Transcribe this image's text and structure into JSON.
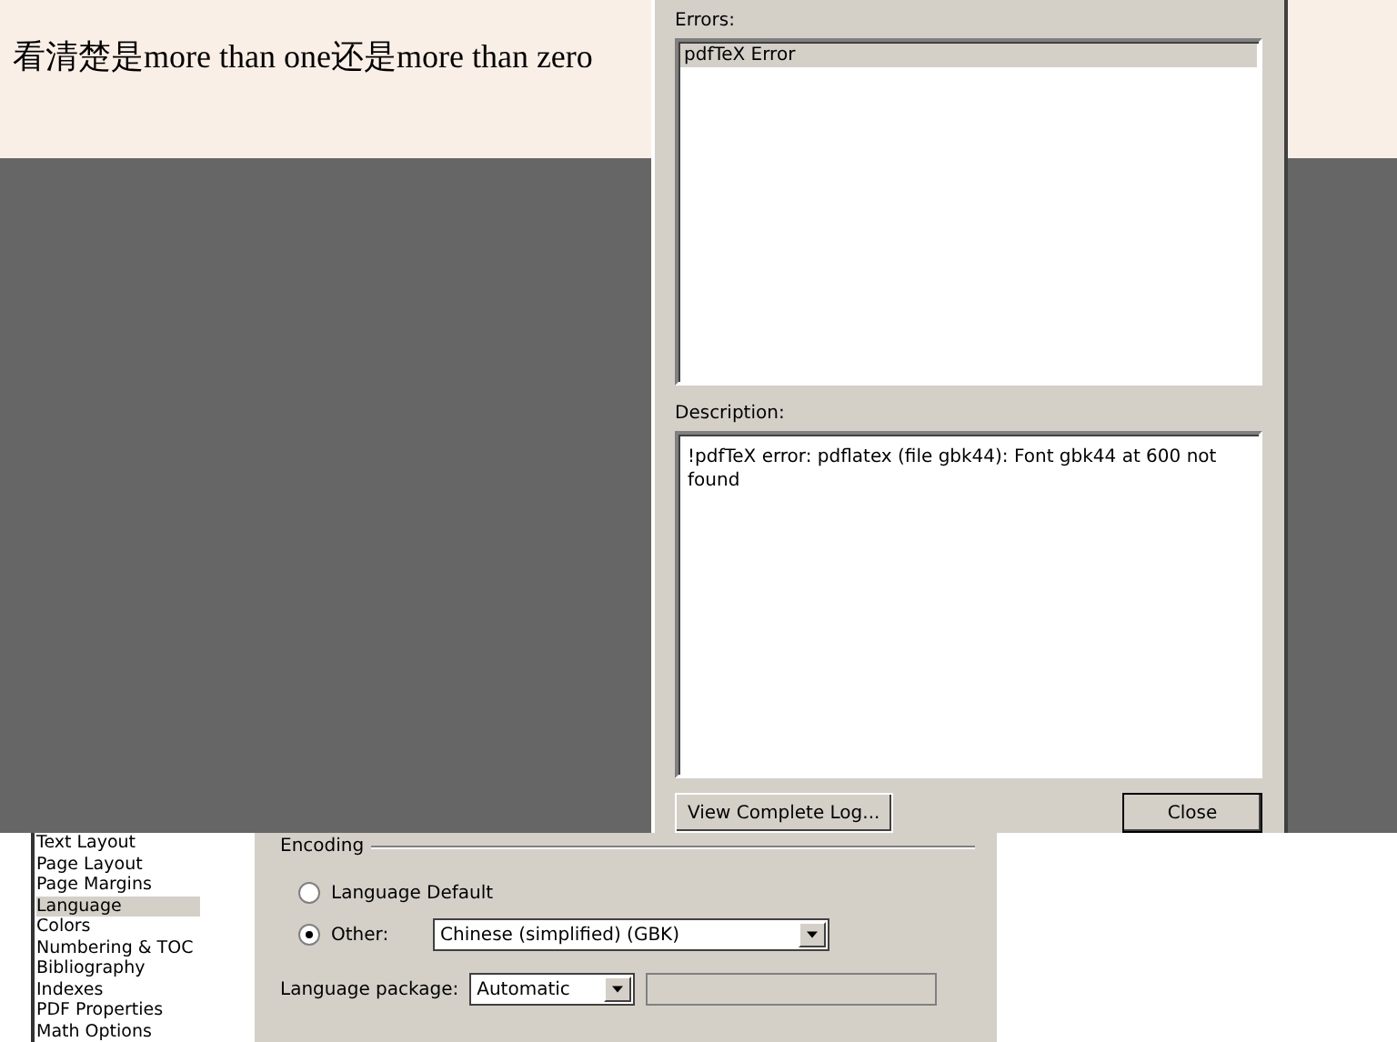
{
  "document": {
    "text": "看清楚是more than one还是more than zero"
  },
  "error_dialog": {
    "errors_label": "Errors:",
    "errors": [
      {
        "text": "pdfTeX Error",
        "selected": true
      }
    ],
    "description_label": "Description:",
    "description": "!pdfTeX error: pdflatex (file gbk44): Font gbk44 at 600 not found",
    "buttons": [
      {
        "label": "View Complete Log...",
        "default": false
      },
      {
        "label": "Close",
        "default": true
      }
    ]
  },
  "settings": {
    "sidebar": {
      "items": [
        {
          "label": "Text Layout",
          "selected": false
        },
        {
          "label": "Page Layout",
          "selected": false
        },
        {
          "label": "Page Margins",
          "selected": false
        },
        {
          "label": "Language",
          "selected": true
        },
        {
          "label": "Colors",
          "selected": false
        },
        {
          "label": "Numbering & TOC",
          "selected": false
        },
        {
          "label": "Bibliography",
          "selected": false
        },
        {
          "label": "Indexes",
          "selected": false
        },
        {
          "label": "PDF Properties",
          "selected": false
        },
        {
          "label": "Math Options",
          "selected": false
        }
      ]
    },
    "encoding": {
      "title": "Encoding",
      "options": [
        {
          "kind": "radio",
          "label": "Language Default",
          "selected": false
        },
        {
          "kind": "radio-select",
          "label": "Other:",
          "selected": true,
          "value": "Chinese (simplified) (GBK)"
        }
      ]
    },
    "language_package": {
      "label": "Language package:",
      "value": "Automatic"
    }
  }
}
